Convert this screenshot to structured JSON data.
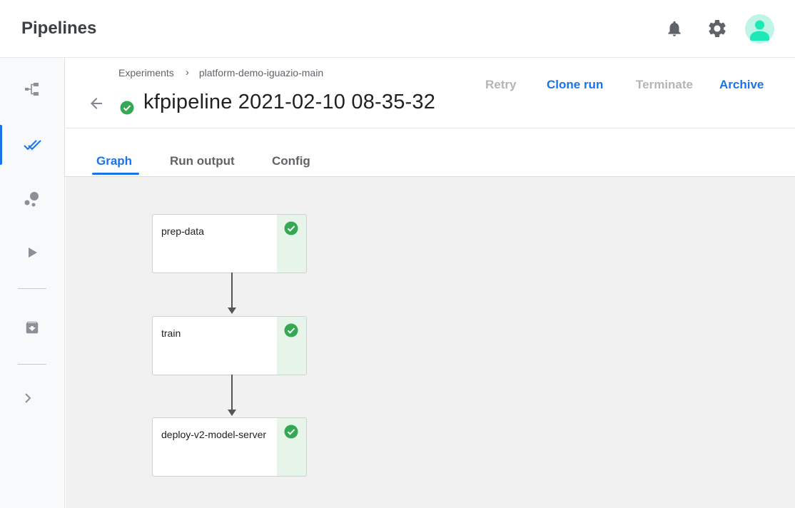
{
  "app": {
    "title": "Pipelines"
  },
  "topbar": {
    "icons": [
      "notifications-icon",
      "settings-icon",
      "account-avatar"
    ]
  },
  "sidebar": {
    "items": [
      {
        "name": "pipelines-nav",
        "icon": "pipeline-icon",
        "active": false
      },
      {
        "name": "experiments-nav",
        "icon": "done-all-icon",
        "active": true
      },
      {
        "name": "artifacts-nav",
        "icon": "bubbles-icon",
        "active": false
      },
      {
        "name": "runs-nav",
        "icon": "play-icon",
        "active": false
      },
      {
        "name": "archive-nav",
        "icon": "archive-icon",
        "active": false
      },
      {
        "name": "expand-nav",
        "icon": "chevron-right-icon",
        "active": false
      }
    ]
  },
  "breadcrumb": {
    "items": [
      "Experiments",
      "platform-demo-iguazio-main"
    ],
    "separator": "›"
  },
  "run": {
    "title": "kfpipeline 2021-02-10 08-35-32",
    "status": "succeeded"
  },
  "actions": {
    "retry": "Retry",
    "clone": "Clone run",
    "terminate": "Terminate",
    "archive": "Archive"
  },
  "tabs": {
    "graph": "Graph",
    "output": "Run output",
    "config": "Config",
    "active": "graph"
  },
  "graph": {
    "nodes": [
      {
        "label": "prep-data",
        "status": "succeeded"
      },
      {
        "label": "train",
        "status": "succeeded"
      },
      {
        "label": "deploy-v2-model-server",
        "status": "succeeded"
      }
    ]
  },
  "colors": {
    "accent": "#1a73e8",
    "success": "#34a853",
    "disabled": "#b5b5b5"
  }
}
